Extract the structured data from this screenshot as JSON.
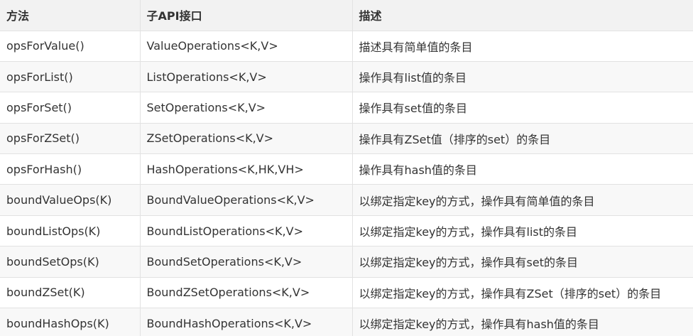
{
  "table": {
    "headers": [
      "方法",
      "子API接口",
      "描述"
    ],
    "rows": [
      [
        "opsForValue()",
        "ValueOperations<K,V>",
        "描述具有简单值的条目"
      ],
      [
        "opsForList()",
        "ListOperations<K,V>",
        "操作具有list值的条目"
      ],
      [
        "opsForSet()",
        "SetOperations<K,V>",
        "操作具有set值的条目"
      ],
      [
        "opsForZSet()",
        "ZSetOperations<K,V>",
        "操作具有ZSet值（排序的set）的条目"
      ],
      [
        "opsForHash()",
        "HashOperations<K,HK,VH>",
        "操作具有hash值的条目"
      ],
      [
        "boundValueOps(K)",
        "BoundValueOperations<K,V>",
        "以绑定指定key的方式，操作具有简单值的条目"
      ],
      [
        "boundListOps(K)",
        "BoundListOperations<K,V>",
        "以绑定指定key的方式，操作具有list的条目"
      ],
      [
        "boundSetOps(K)",
        "BoundSetOperations<K,V>",
        "以绑定指定key的方式，操作具有set的条目"
      ],
      [
        "boundZSet(K)",
        "BoundZSetOperations<K,V>",
        "以绑定指定key的方式，操作具有ZSet（排序的set）的条目"
      ],
      [
        "boundHashOps(K)",
        "BoundHashOperations<K,V>",
        "以绑定指定key的方式，操作具有hash值的条目"
      ]
    ]
  }
}
